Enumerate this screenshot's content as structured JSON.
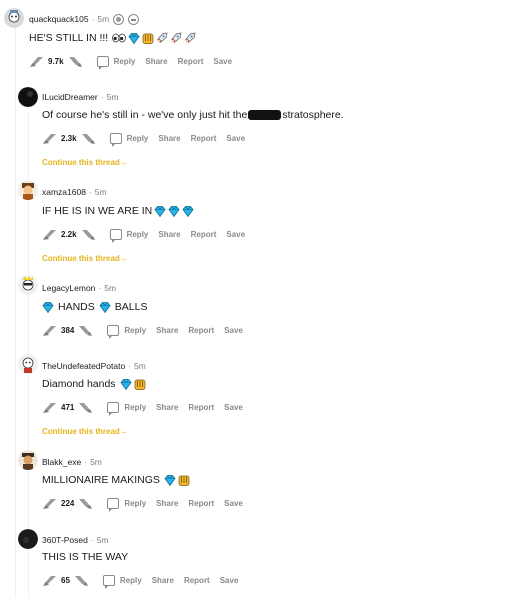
{
  "actions": {
    "reply": "Reply",
    "share": "Share",
    "report": "Report",
    "save": "Save"
  },
  "continue_label": "Continue this thread",
  "continue_arrow": "→",
  "comments": [
    {
      "user": "quackquack105",
      "time": "5m",
      "text": "HE'S STILL IN !!!",
      "score": "9.7k"
    },
    {
      "user": "ILucidDreamer",
      "time": "5m",
      "text_before": "Of course he's still in - we've only just hit the",
      "text_after": "stratosphere.",
      "score": "2.3k"
    },
    {
      "user": "xamza1608",
      "time": "5m",
      "text": "IF HE IS IN WE ARE IN",
      "score": "2.2k"
    },
    {
      "user": "LegacyLemon",
      "time": "5m",
      "text_a": "HANDS",
      "text_b": "BALLS",
      "score": "384"
    },
    {
      "user": "TheUndefeatedPotato",
      "time": "5m",
      "text": "Diamond hands",
      "score": "471"
    },
    {
      "user": "Blakk_exe",
      "time": "5m",
      "text": "MILLIONAIRE MAKINGS",
      "score": "224"
    },
    {
      "user": "360T-Posed",
      "time": "5m",
      "text": "THIS IS THE WAY",
      "score": "65"
    }
  ],
  "colors": {
    "continue": "#e8b41c",
    "diamond": "#1aa0d8",
    "muted": "#878a8c"
  },
  "icons": {
    "diamond": "diamond-icon",
    "hands": "raised-hands-icon",
    "eyes": "eyes-icon",
    "rocket": "rocket-icon",
    "upvote": "upvote-icon",
    "downvote": "downvote-icon"
  }
}
